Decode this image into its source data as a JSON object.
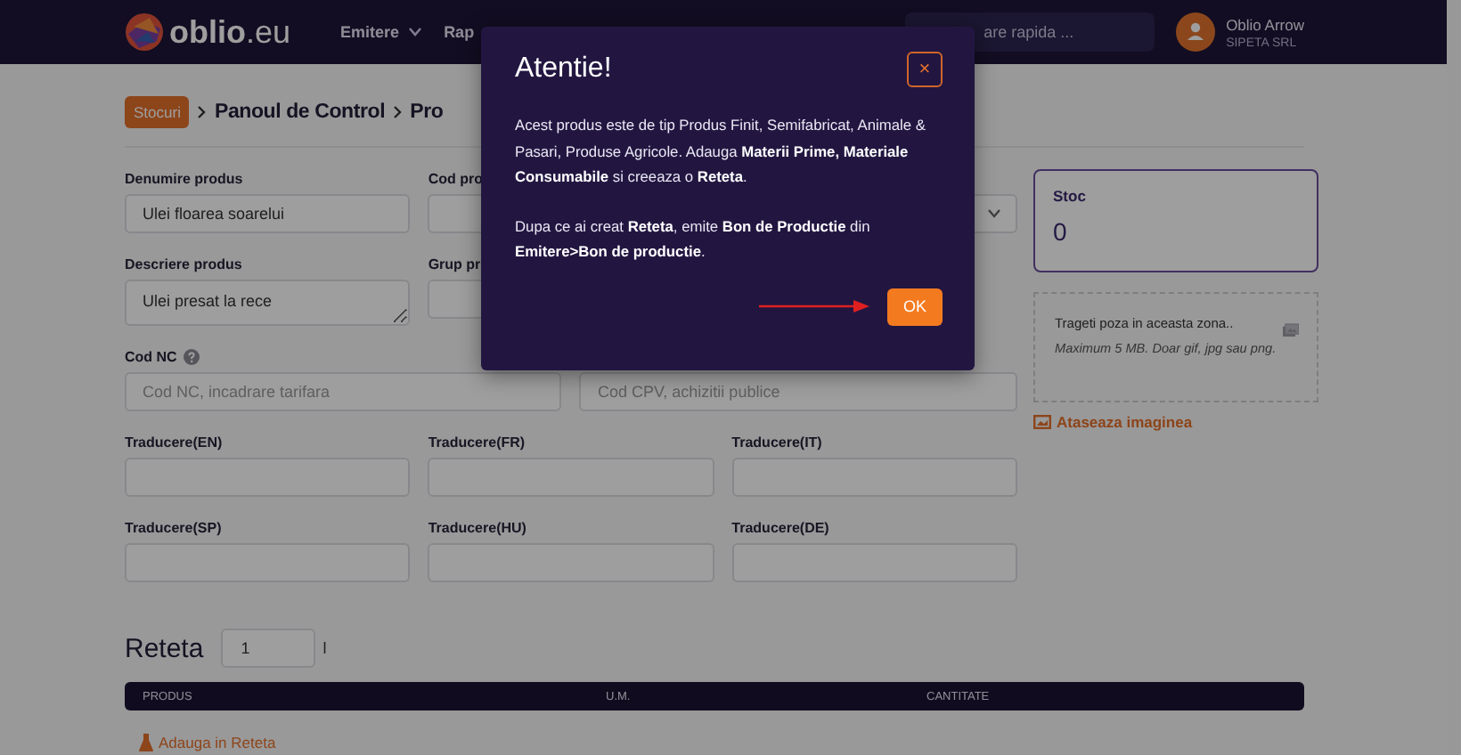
{
  "navbar": {
    "logo": "**oblio**.eu",
    "menu": [
      {
        "label": "Emitere",
        "dropdown": true
      },
      {
        "label": "Rap",
        "dropdown": false
      }
    ],
    "search": {
      "placeholder": "are rapida ..."
    },
    "user": {
      "name": "Oblio Arrow",
      "company": "SIPETA SRL"
    }
  },
  "breadcrumb": [
    {
      "label": "Stocuri",
      "kind": "badge"
    },
    {
      "label": "Panoul de Control",
      "kind": "text"
    },
    {
      "label": "Pro",
      "kind": "text"
    }
  ],
  "form": {
    "fields": [
      {
        "label": "Denumire produs",
        "kind": "input",
        "value": "Ulei floarea soarelui",
        "wide": false
      },
      {
        "label": "Cod pro",
        "kind": "input",
        "wide": false
      },
      {
        "kind": "select",
        "wide": false
      },
      {
        "label": "Descriere produs",
        "kind": "textarea",
        "value": "Ulei presat la rece",
        "wide": false
      },
      {
        "label": "Grup pr",
        "kind": "input",
        "wide": false
      },
      {
        "kind": "blank",
        "wide": false
      },
      {
        "label": "Cod NC",
        "kind": "input",
        "help": true,
        "placeholder": "Cod NC, incadrare tarifara",
        "wide": true
      },
      {
        "kind": "input",
        "placeholder": "Cod CPV, achizitii publice",
        "wide": true
      },
      {
        "label": "Traducere(EN)",
        "kind": "input",
        "wide": false
      },
      {
        "label": "Traducere(FR)",
        "kind": "input",
        "wide": false
      },
      {
        "label": "Traducere(IT)",
        "kind": "input",
        "wide": false
      },
      {
        "label": "Traducere(SP)",
        "kind": "input",
        "wide": false
      },
      {
        "label": "Traducere(HU)",
        "kind": "input",
        "wide": false
      },
      {
        "label": "Traducere(DE)",
        "kind": "input",
        "wide": false
      }
    ]
  },
  "stock": {
    "label": "Stoc",
    "value": "0"
  },
  "dropzone": {
    "text": "Trageti poza in aceasta zona..",
    "hint": "Maximum 5 MB. Doar gif, jpg sau png."
  },
  "attach_link": "Ataseaza imaginea",
  "recipe": {
    "title": "Reteta",
    "quantity": "1",
    "unit": "l",
    "columns": [
      "PRODUS",
      "U.M.",
      "CANTITATE"
    ],
    "add_link": "Adauga in Reteta"
  },
  "modal": {
    "title": "Atentie!",
    "close": "×",
    "paragraphs": [
      "Acest produs este de tip Produs Finit, Semifabricat, Animale & Pasari, Produse Agricole. Adauga **Materii Prime, Materiale Consumabile** si creeaza o **Reteta**.",
      "Dupa ce ai creat **Reteta**, emite **Bon de Productie** din **Emitere>Bon de productie**."
    ],
    "ok": "OK"
  }
}
